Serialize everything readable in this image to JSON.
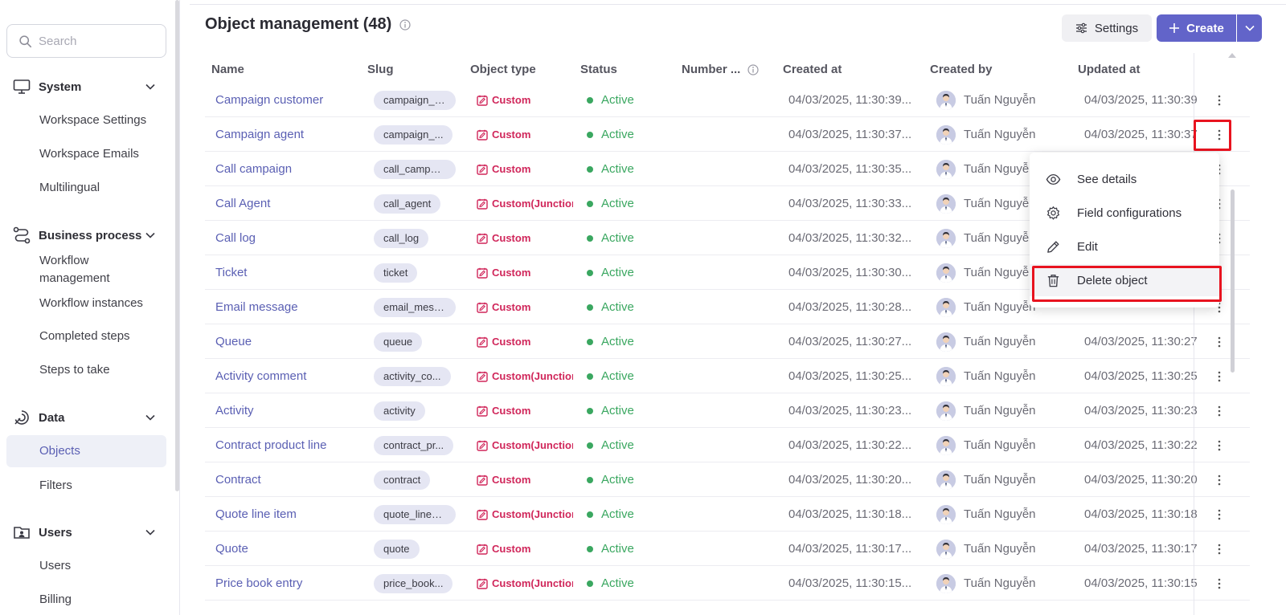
{
  "sidebar": {
    "search_placeholder": "Search",
    "groups": [
      {
        "label": "System",
        "icon": "monitor-icon",
        "items": [
          "Workspace Settings",
          "Workspace Emails",
          "Multilingual"
        ]
      },
      {
        "label": "Business process",
        "icon": "process-flow-icon",
        "items": [
          "Workflow management",
          "Workflow instances",
          "Completed steps",
          "Steps to take"
        ]
      },
      {
        "label": "Data",
        "icon": "data-icon",
        "items": [
          "Objects",
          "Filters"
        ]
      },
      {
        "label": "Users",
        "icon": "users-icon",
        "items": [
          "Users",
          "Billing"
        ]
      }
    ],
    "active_item": "Objects"
  },
  "header": {
    "title": "Object management (48)",
    "settings_label": "Settings",
    "create_label": "Create"
  },
  "table": {
    "columns": [
      "Name",
      "Slug",
      "Object type",
      "Status",
      "Number ...",
      "Created at",
      "Created by",
      "Updated at"
    ],
    "rows": [
      {
        "name": "Campaign customer",
        "slug": "campaign_c...",
        "type": "Custom",
        "status": "Active",
        "created": "04/03/2025, 11:30:39...",
        "by": "Tuấn Nguyễn",
        "updated": "04/03/2025, 11:30:39"
      },
      {
        "name": "Campaign agent",
        "slug": "campaign_...",
        "type": "Custom",
        "status": "Active",
        "created": "04/03/2025, 11:30:37...",
        "by": "Tuấn Nguyễn",
        "updated": "04/03/2025, 11:30:37"
      },
      {
        "name": "Call campaign",
        "slug": "call_campai...",
        "type": "Custom",
        "status": "Active",
        "created": "04/03/2025, 11:30:35...",
        "by": "Tuấn Nguyễn",
        "updated": ""
      },
      {
        "name": "Call Agent",
        "slug": "call_agent",
        "type": "Custom(Junctior",
        "status": "Active",
        "created": "04/03/2025, 11:30:33...",
        "by": "Tuấn Nguyễn",
        "updated": ""
      },
      {
        "name": "Call log",
        "slug": "call_log",
        "type": "Custom",
        "status": "Active",
        "created": "04/03/2025, 11:30:32...",
        "by": "Tuấn Nguyễn",
        "updated": ""
      },
      {
        "name": "Ticket",
        "slug": "ticket",
        "type": "Custom",
        "status": "Active",
        "created": "04/03/2025, 11:30:30...",
        "by": "Tuấn Nguyễn",
        "updated": ""
      },
      {
        "name": "Email message",
        "slug": "email_mess...",
        "type": "Custom",
        "status": "Active",
        "created": "04/03/2025, 11:30:28...",
        "by": "Tuấn Nguyễn",
        "updated": ""
      },
      {
        "name": "Queue",
        "slug": "queue",
        "type": "Custom",
        "status": "Active",
        "created": "04/03/2025, 11:30:27...",
        "by": "Tuấn Nguyễn",
        "updated": "04/03/2025, 11:30:27"
      },
      {
        "name": "Activity comment",
        "slug": "activity_co...",
        "type": "Custom(Junctior",
        "status": "Active",
        "created": "04/03/2025, 11:30:25...",
        "by": "Tuấn Nguyễn",
        "updated": "04/03/2025, 11:30:25"
      },
      {
        "name": "Activity",
        "slug": "activity",
        "type": "Custom",
        "status": "Active",
        "created": "04/03/2025, 11:30:23...",
        "by": "Tuấn Nguyễn",
        "updated": "04/03/2025, 11:30:23"
      },
      {
        "name": "Contract product line",
        "slug": "contract_pr...",
        "type": "Custom(Junctior",
        "status": "Active",
        "created": "04/03/2025, 11:30:22...",
        "by": "Tuấn Nguyễn",
        "updated": "04/03/2025, 11:30:22"
      },
      {
        "name": "Contract",
        "slug": "contract",
        "type": "Custom",
        "status": "Active",
        "created": "04/03/2025, 11:30:20...",
        "by": "Tuấn Nguyễn",
        "updated": "04/03/2025, 11:30:20"
      },
      {
        "name": "Quote line item",
        "slug": "quote_line_...",
        "type": "Custom(Junctior",
        "status": "Active",
        "created": "04/03/2025, 11:30:18...",
        "by": "Tuấn Nguyễn",
        "updated": "04/03/2025, 11:30:18"
      },
      {
        "name": "Quote",
        "slug": "quote",
        "type": "Custom",
        "status": "Active",
        "created": "04/03/2025, 11:30:17...",
        "by": "Tuấn Nguyễn",
        "updated": "04/03/2025, 11:30:17"
      },
      {
        "name": "Price book entry",
        "slug": "price_book...",
        "type": "Custom(Junctior",
        "status": "Active",
        "created": "04/03/2025, 11:30:15...",
        "by": "Tuấn Nguyễn",
        "updated": "04/03/2025, 11:30:15"
      }
    ]
  },
  "row_menu": {
    "items": [
      {
        "label": "See details",
        "icon": "eye-icon"
      },
      {
        "label": "Field configurations",
        "icon": "gear-icon"
      },
      {
        "label": "Edit",
        "icon": "pencil-icon"
      },
      {
        "label": "Delete object",
        "icon": "trash-icon"
      }
    ]
  },
  "colors": {
    "accent": "#6264c9",
    "link": "#5a5fb3",
    "custom_type": "#d0265a",
    "active_status": "#3aa760",
    "highlight": "#e8131f"
  }
}
